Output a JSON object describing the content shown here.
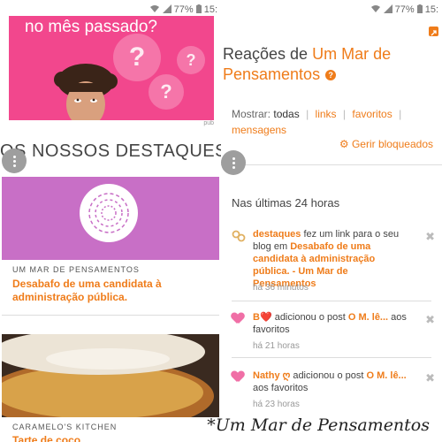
{
  "status": {
    "battery_left": "77%",
    "time_left": "15:",
    "battery_right": "77%",
    "time_right": "15:"
  },
  "left": {
    "ad_text": "no mês passado?",
    "pub_label": "pub",
    "section_title": "OS NOSSOS DESTAQUES",
    "cards": [
      {
        "blog": "UM MAR DE PENSAMENTOS",
        "title": "Desabafo de uma candidata à administração pública."
      },
      {
        "blog": "CARAMELO'S KITCHEN",
        "title": "Tarte de coco"
      }
    ]
  },
  "right": {
    "title_prefix": "Reações de ",
    "blog_name": "Um Mar de Pensamentos",
    "filter_label": "Mostrar:",
    "filters": [
      "todas",
      "links",
      "favoritos",
      "mensagens"
    ],
    "manage_blocked": "Gerir bloqueados",
    "section_heading": "Nas últimas 24 horas",
    "activities": [
      {
        "user": "destaques",
        "text_a": " fez um link para o seu blog em ",
        "post": "Desabafo de uma candidata à administração pública. - Um Mar de Pensamentos",
        "time": "há 36 minutos"
      },
      {
        "user": "B❤️",
        "text_a": " adicionou o post ",
        "post": "O M. lê...",
        "text_b": " aos favoritos",
        "time": "há 21 horas"
      },
      {
        "user": "Nathy ღ",
        "text_a": " adicionou o post ",
        "post": "O M. lê...",
        "text_b": " aos favoritos",
        "time": "há 23 horas"
      }
    ]
  },
  "watermark": "*Um Mar de Pensamentos",
  "colors": {
    "accent": "#ef7c1a",
    "ad_pink": "#f2478d",
    "card_purple": "#c86fc6",
    "heart": "#f06fa6"
  }
}
